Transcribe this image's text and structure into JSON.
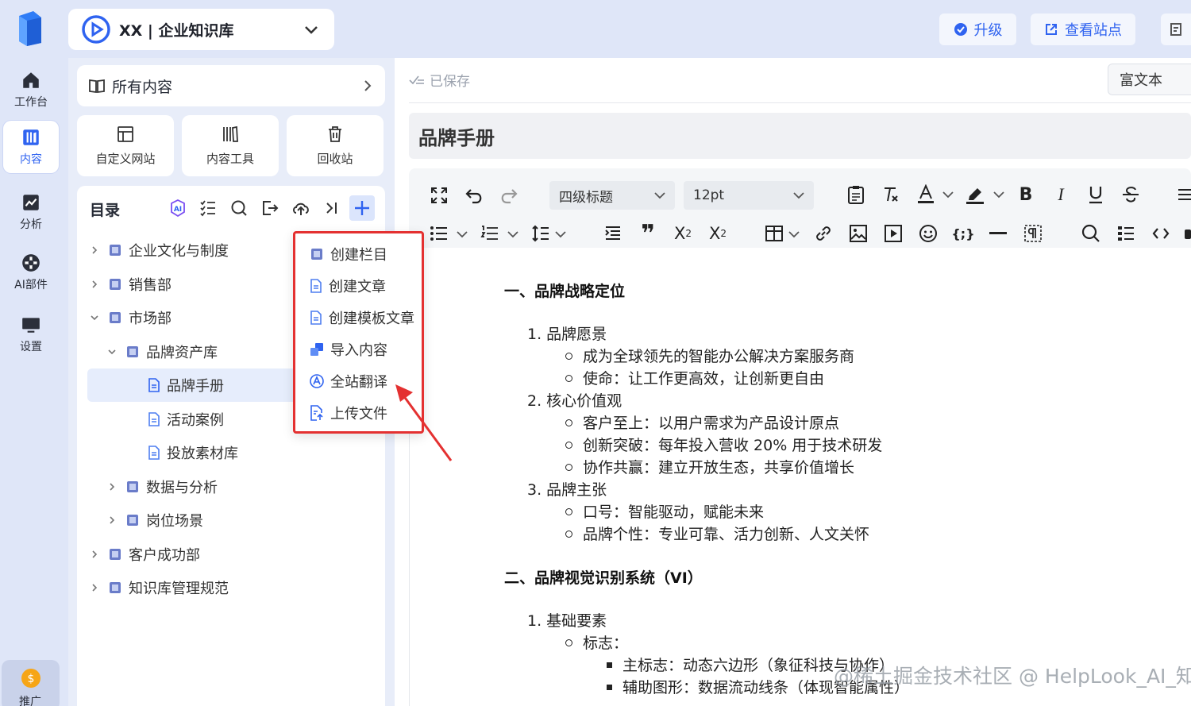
{
  "space": {
    "name": "XX | 企业知识库"
  },
  "topbar": {
    "upgrade": "升级",
    "view_site": "查看站点"
  },
  "rail": {
    "items": [
      {
        "label": "工作台",
        "icon": "home-icon"
      },
      {
        "label": "内容",
        "icon": "book-icon"
      },
      {
        "label": "分析",
        "icon": "chart-icon"
      },
      {
        "label": "AI部件",
        "icon": "ai-part-icon"
      },
      {
        "label": "设置",
        "icon": "monitor-icon"
      }
    ],
    "promo": "推广"
  },
  "panel": {
    "all_content": "所有内容",
    "tools": [
      {
        "label": "自定义网站",
        "icon": "layout-icon"
      },
      {
        "label": "内容工具",
        "icon": "books-icon"
      },
      {
        "label": "回收站",
        "icon": "trash-icon"
      }
    ],
    "toc_title": "目录",
    "tree": [
      {
        "label": "企业文化与制度",
        "type": "folder",
        "state": "collapsed"
      },
      {
        "label": "销售部",
        "type": "folder",
        "state": "collapsed"
      },
      {
        "label": "市场部",
        "type": "folder",
        "state": "expanded"
      },
      {
        "label": "品牌资产库",
        "type": "folder",
        "state": "expanded"
      },
      {
        "label": "品牌手册",
        "type": "doc",
        "state": "selected"
      },
      {
        "label": "活动案例",
        "type": "doc",
        "state": "leaf"
      },
      {
        "label": "投放素材库",
        "type": "doc",
        "state": "leaf"
      },
      {
        "label": "数据与分析",
        "type": "folder",
        "state": "collapsed"
      },
      {
        "label": "岗位场景",
        "type": "folder",
        "state": "collapsed"
      },
      {
        "label": "客户成功部",
        "type": "folder",
        "state": "collapsed"
      },
      {
        "label": "知识库管理规范",
        "type": "folder",
        "state": "collapsed"
      }
    ]
  },
  "menu": {
    "items": [
      {
        "label": "创建栏目",
        "icon": "folder-book-icon"
      },
      {
        "label": "创建文章",
        "icon": "doc-icon"
      },
      {
        "label": "创建模板文章",
        "icon": "template-doc-icon"
      },
      {
        "label": "导入内容",
        "icon": "import-icon"
      },
      {
        "label": "全站翻译",
        "icon": "translate-icon"
      },
      {
        "label": "上传文件",
        "icon": "upload-file-icon"
      }
    ]
  },
  "editor": {
    "saved": "已保存",
    "format": "富文本",
    "title": "品牌手册",
    "heading_select": "四级标题",
    "size_select": "12pt"
  },
  "doc": {
    "h1": "一、品牌战略定位",
    "i1": "1. 品牌愿景",
    "i1a": "成为全球领先的智能办公解决方案服务商",
    "i1b": "使命：让工作更高效，让创新更自由",
    "i2": "2. 核心价值观",
    "i2a": "客户至上：以用户需求为产品设计原点",
    "i2b": "创新突破：每年投入营收 20% 用于技术研发",
    "i2c": "协作共赢：建立开放生态，共享价值增长",
    "i3": "3. 品牌主张",
    "i3a": "口号：智能驱动，赋能未来",
    "i3b": "品牌个性：专业可靠、活力创新、人文关怀",
    "h2": "二、品牌视觉识别系统（VI）",
    "j1": "1. 基础要素",
    "j1a": "标志：",
    "j1a1": "主标志：动态六边形（象征科技与协作）",
    "j1a2": "辅助图形：数据流动线条（体现智能属性）"
  },
  "watermark": "@稀土掘金技术社区 @ HelpLook_AI_知识库",
  "colors": {
    "accent": "#2f63f0",
    "highlight_border": "#e43131",
    "rail_bg": "#dfe6f8"
  }
}
